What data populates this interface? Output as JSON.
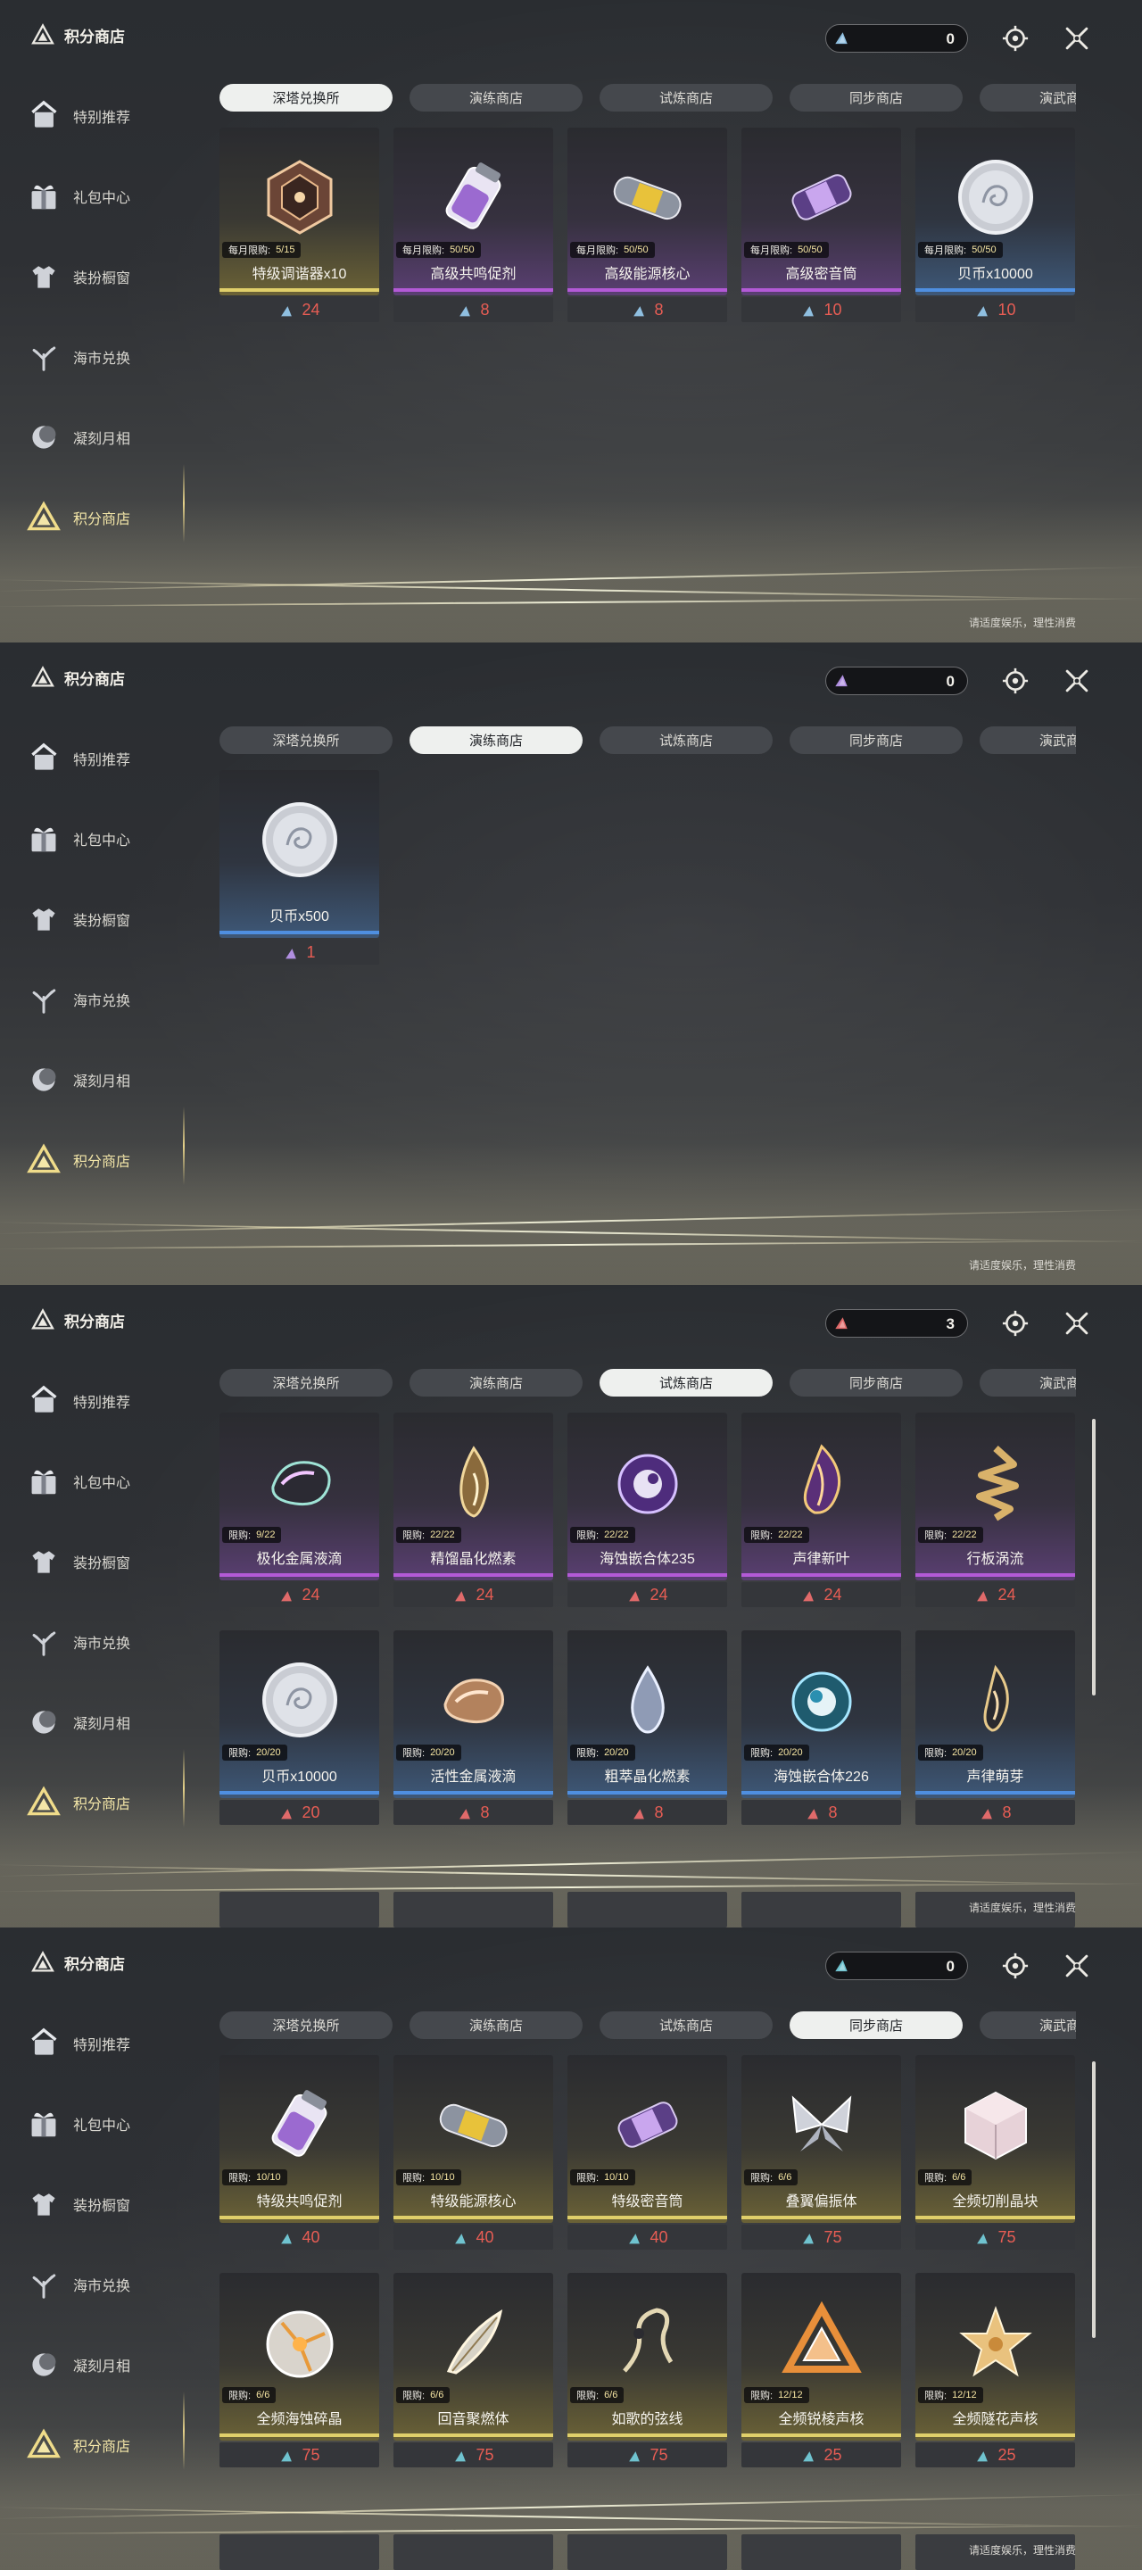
{
  "common": {
    "title": "积分商店",
    "footer": "请适度娱乐，理性消费",
    "nav": [
      {
        "label": "特别推荐",
        "icon": "recommend-icon"
      },
      {
        "label": "礼包中心",
        "icon": "gift-icon"
      },
      {
        "label": "装扮橱窗",
        "icon": "wardrobe-icon"
      },
      {
        "label": "海市兑换",
        "icon": "coral-icon"
      },
      {
        "label": "凝刻月相",
        "icon": "moon-icon"
      },
      {
        "label": "积分商店",
        "icon": "points-shop-icon"
      }
    ],
    "tabs": [
      "深塔兑换所",
      "演练商店",
      "试炼商店",
      "同步商店",
      "演武商店"
    ]
  },
  "panels": [
    {
      "currency_value": "0",
      "currency_color": "#8fbfe0",
      "active_tab": 0,
      "items": [
        {
          "name": "特级调谐器x10",
          "limit_label": "每月限购:",
          "limit_value": "5/15",
          "price": "24",
          "rarity": "gold",
          "art": "tuner"
        },
        {
          "name": "高级共鸣促剂",
          "limit_label": "每月限购:",
          "limit_value": "50/50",
          "price": "8",
          "rarity": "purple",
          "art": "vial"
        },
        {
          "name": "高级能源核心",
          "limit_label": "每月限购:",
          "limit_value": "50/50",
          "price": "8",
          "rarity": "purple",
          "art": "capsule"
        },
        {
          "name": "高级密音筒",
          "limit_label": "每月限购:",
          "limit_value": "50/50",
          "price": "10",
          "rarity": "purple",
          "art": "cylinder"
        },
        {
          "name": "贝币x10000",
          "limit_label": "每月限购:",
          "limit_value": "50/50",
          "price": "10",
          "rarity": "blue",
          "art": "coin"
        }
      ]
    },
    {
      "currency_value": "0",
      "currency_color": "#b08fe0",
      "active_tab": 1,
      "items": [
        {
          "name": "贝币x500",
          "limit_label": "",
          "limit_value": "",
          "price": "1",
          "rarity": "blue",
          "art": "coin"
        }
      ]
    },
    {
      "currency_value": "3",
      "currency_color": "#e06a6a",
      "active_tab": 2,
      "items": [
        {
          "name": "极化金属液滴",
          "limit_label": "限购:",
          "limit_value": "9/22",
          "price": "24",
          "rarity": "purple",
          "art": "droplet"
        },
        {
          "name": "精馏晶化燃素",
          "limit_label": "限购:",
          "limit_value": "22/22",
          "price": "24",
          "rarity": "purple",
          "art": "flame"
        },
        {
          "name": "海蚀嵌合体235",
          "limit_label": "限购:",
          "limit_value": "22/22",
          "price": "24",
          "rarity": "purple",
          "art": "orb"
        },
        {
          "name": "声律新叶",
          "limit_label": "限购:",
          "limit_value": "22/22",
          "price": "24",
          "rarity": "purple",
          "art": "leafflame"
        },
        {
          "name": "行板涡流",
          "limit_label": "限购:",
          "limit_value": "22/22",
          "price": "24",
          "rarity": "purple",
          "art": "spiral"
        },
        {
          "name": "贝币x10000",
          "limit_label": "限购:",
          "limit_value": "20/20",
          "price": "20",
          "rarity": "blue",
          "art": "coin"
        },
        {
          "name": "活性金属液滴",
          "limit_label": "限购:",
          "limit_value": "20/20",
          "price": "8",
          "rarity": "blue",
          "art": "droplet2"
        },
        {
          "name": "粗萃晶化燃素",
          "limit_label": "限购:",
          "limit_value": "20/20",
          "price": "8",
          "rarity": "blue",
          "art": "drop"
        },
        {
          "name": "海蚀嵌合体226",
          "limit_label": "限购:",
          "limit_value": "20/20",
          "price": "8",
          "rarity": "blue",
          "art": "orb2"
        },
        {
          "name": "声律萌芽",
          "limit_label": "限购:",
          "limit_value": "20/20",
          "price": "8",
          "rarity": "blue",
          "art": "sprout"
        }
      ]
    },
    {
      "currency_value": "0",
      "currency_color": "#6fc3cf",
      "active_tab": 3,
      "items": [
        {
          "name": "特级共鸣促剂",
          "limit_label": "限购:",
          "limit_value": "10/10",
          "price": "40",
          "rarity": "gold",
          "art": "vial"
        },
        {
          "name": "特级能源核心",
          "limit_label": "限购:",
          "limit_value": "10/10",
          "price": "40",
          "rarity": "gold",
          "art": "capsule"
        },
        {
          "name": "特级密音筒",
          "limit_label": "限购:",
          "limit_value": "10/10",
          "price": "40",
          "rarity": "gold",
          "art": "cylinder"
        },
        {
          "name": "叠翼偏振体",
          "limit_label": "限购:",
          "limit_value": "6/6",
          "price": "75",
          "rarity": "gold",
          "art": "butterfly"
        },
        {
          "name": "全频切削晶块",
          "limit_label": "限购:",
          "limit_value": "6/6",
          "price": "75",
          "rarity": "gold",
          "art": "cube"
        },
        {
          "name": "全频海蚀碎晶",
          "limit_label": "限购:",
          "limit_value": "6/6",
          "price": "75",
          "rarity": "gold",
          "art": "shard"
        },
        {
          "name": "回音聚燃体",
          "limit_label": "限购:",
          "limit_value": "6/6",
          "price": "75",
          "rarity": "gold",
          "art": "feather"
        },
        {
          "name": "如歌的弦线",
          "limit_label": "限购:",
          "limit_value": "6/6",
          "price": "75",
          "rarity": "gold",
          "art": "string"
        },
        {
          "name": "全频锐棱声核",
          "limit_label": "限购:",
          "limit_value": "12/12",
          "price": "25",
          "rarity": "gold",
          "art": "prism"
        },
        {
          "name": "全频隧花声核",
          "limit_label": "限购:",
          "limit_value": "12/12",
          "price": "25",
          "rarity": "gold",
          "art": "flower"
        }
      ]
    }
  ],
  "colors": {
    "gold": "#e0cf6a",
    "purple": "#b35ad6",
    "blue": "#4f8fe0",
    "price": "#e85d54",
    "active_nav": "#f3e6a8"
  }
}
